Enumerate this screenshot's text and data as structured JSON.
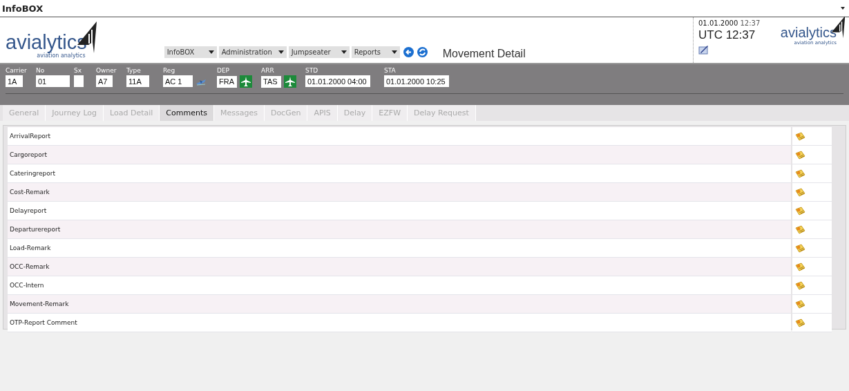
{
  "window": {
    "title": "InfoBOX"
  },
  "logos": [
    {
      "name": "avialytics",
      "tagline": "aviation analytics"
    },
    {
      "name": "avialytics",
      "tagline": "aviation analytics"
    }
  ],
  "menus": [
    {
      "label": "InfoBOX"
    },
    {
      "label": "Administration"
    },
    {
      "label": "Jumpseater"
    },
    {
      "label": "Reports"
    }
  ],
  "page_title": "Movement Detail",
  "clock": {
    "local_date": "01.01.2000",
    "local_time": "12:37",
    "utc": "UTC 12:37"
  },
  "fields": [
    {
      "label": "Carrier",
      "value": "1A",
      "kind": "plain"
    },
    {
      "label": "No",
      "value": "01",
      "kind": "plain"
    },
    {
      "label": "Sx",
      "kind": "plain"
    },
    {
      "label": "Owner",
      "value": "A7",
      "kind": "plain"
    },
    {
      "label": "Type",
      "value": "11A",
      "kind": "plain"
    },
    {
      "label": "Reg",
      "value": "AC 1",
      "kind": "registration"
    },
    {
      "label": "DEP",
      "value": "FRA",
      "kind": "station"
    },
    {
      "label": "ARR",
      "value": "TAS",
      "kind": "station"
    },
    {
      "label": "STD",
      "value": "01.01.2000 04:00",
      "kind": "plain"
    },
    {
      "label": "STA",
      "value": "01.01.2000 10:25",
      "kind": "plain"
    }
  ],
  "tabs": [
    {
      "label": "General",
      "selected": false
    },
    {
      "label": "Journey Log",
      "selected": false
    },
    {
      "label": "Load Detail",
      "selected": false
    },
    {
      "label": "Comments",
      "selected": true
    },
    {
      "label": "Messages",
      "selected": false
    },
    {
      "label": "DocGen",
      "selected": false
    },
    {
      "label": "APIS",
      "selected": false
    },
    {
      "label": "Delay",
      "selected": false
    },
    {
      "label": "EZFW",
      "selected": false
    },
    {
      "label": "Delay Request",
      "selected": false
    }
  ],
  "comments": [
    {
      "label": "ArrivalReport"
    },
    {
      "label": "Cargoreport"
    },
    {
      "label": "Cateringreport"
    },
    {
      "label": "Cost-Remark"
    },
    {
      "label": "Delayreport"
    },
    {
      "label": "Departurereport"
    },
    {
      "label": "Load-Remark"
    },
    {
      "label": "OCC-Remark"
    },
    {
      "label": "OCC-Intern"
    },
    {
      "label": "Movement-Remark"
    },
    {
      "label": "OTP-Report Comment"
    }
  ]
}
